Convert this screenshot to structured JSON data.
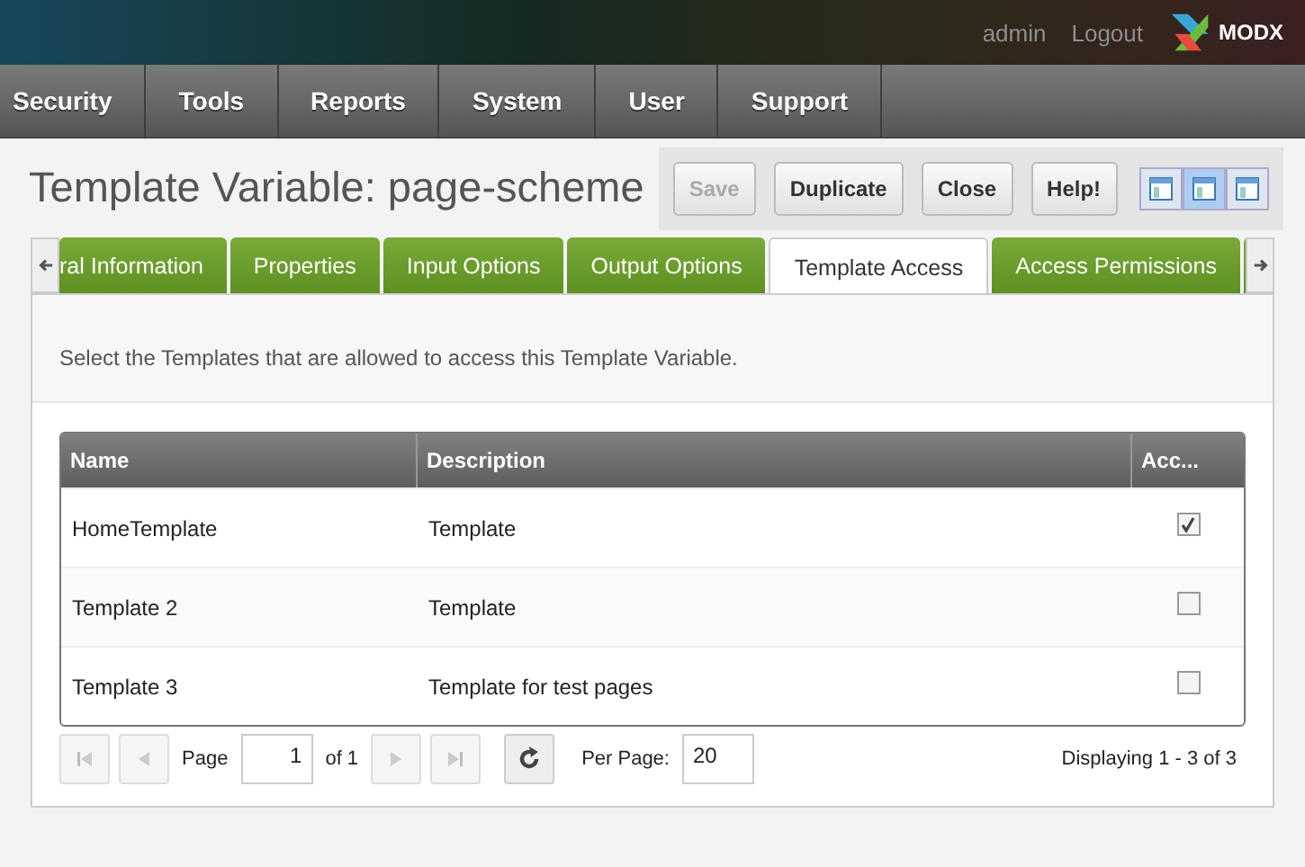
{
  "header": {
    "user": "admin",
    "logout": "Logout",
    "logo": "MODX"
  },
  "nav": [
    "Security",
    "Tools",
    "Reports",
    "System",
    "User",
    "Support"
  ],
  "title": "Template Variable: page-scheme",
  "buttons": [
    {
      "label": "Save",
      "disabled": true
    },
    {
      "label": "Duplicate",
      "disabled": false
    },
    {
      "label": "Close",
      "disabled": false
    },
    {
      "label": "Help!",
      "disabled": false
    }
  ],
  "views": [
    {
      "selected": false
    },
    {
      "selected": true
    },
    {
      "selected": false
    }
  ],
  "tabs": [
    {
      "label": "ral Information",
      "selected": false
    },
    {
      "label": "Properties",
      "selected": false
    },
    {
      "label": "Input Options",
      "selected": false
    },
    {
      "label": "Output Options",
      "selected": false
    },
    {
      "label": "Template Access",
      "selected": true
    },
    {
      "label": "Access Permissions",
      "selected": false
    }
  ],
  "description": "Select the Templates that are allowed to access this Template Variable.",
  "table": {
    "columns": [
      "Name",
      "Description",
      "Acc..."
    ],
    "rows": [
      {
        "name": "HomeTemplate",
        "description": "Template",
        "checked": true
      },
      {
        "name": "Template 2",
        "description": "Template",
        "checked": false
      },
      {
        "name": "Template 3",
        "description": "Template for test pages",
        "checked": false
      }
    ]
  },
  "pager": {
    "page_label": "Page",
    "page": "1",
    "of": "of 1",
    "per_page_label": "Per Page:",
    "per_page": "20",
    "displaying": "Displaying 1 - 3 of 3"
  }
}
